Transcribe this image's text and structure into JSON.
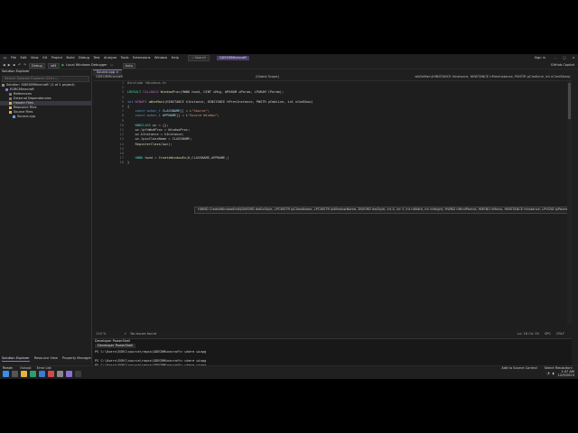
{
  "menu": {
    "items": [
      "File",
      "Edit",
      "View",
      "Git",
      "Project",
      "Build",
      "Debug",
      "Test",
      "Analyze",
      "Tools",
      "Extensions",
      "Window",
      "Help"
    ],
    "search_label": "Search",
    "project": "GDEGRMinecraft",
    "signin": "Sign in",
    "copilot": "GitHub Copilot"
  },
  "toolbar": {
    "config": "Debug",
    "platform": "x64",
    "run_label": "Local Windows Debugger",
    "auto": "Auto"
  },
  "explorer": {
    "title": "Solution Explorer",
    "search_placeholder": "Search Solution Explorer (Ctrl+;)",
    "items": [
      {
        "label": "Solution 'GDEGRMinecraft' (1 of 1 project)",
        "indent": 0,
        "color": "#8a8a8a"
      },
      {
        "label": "EGRCMinecraft",
        "indent": 1,
        "color": "#8c6fd0"
      },
      {
        "label": "References",
        "indent": 2,
        "color": "#7a7a7a"
      },
      {
        "label": "External Dependencies",
        "indent": 2,
        "color": "#7a7a7a"
      },
      {
        "label": "Header Files",
        "indent": 2,
        "color": "#d8b05a"
      },
      {
        "label": "Resource Files",
        "indent": 2,
        "color": "#d8b05a"
      },
      {
        "label": "Source Files",
        "indent": 2,
        "color": "#d8b05a"
      },
      {
        "label": "Source.cpp",
        "indent": 3,
        "color": "#6c9ad6"
      }
    ],
    "selected_index": 4,
    "tabs": [
      "Solution Explorer",
      "Resource View",
      "Property Manager"
    ]
  },
  "editor": {
    "tab": "Source.cpp",
    "nav": [
      "GDEGRMinecraft",
      "(Global Scope)",
      "wWinMain(HINSTANCE hInstance, HINSTANCE hPrevInstance, PWSTR pCmdLine, int nCmdShow)"
    ],
    "tooltip": "HWND CreateWindowExW(DWORD dwExStyle, LPCWSTR lpClassName, LPCWSTR lpWindowName, DWORD dwStyle, int X, int Y, int nWidth, int nHeight, HWND hWndParent, HMENU hMenu, HINSTANCE hInstance, LPVOID lpParam)",
    "status": {
      "zoom": "110 %",
      "issues": "No issues found",
      "position": "Ln: 18  Ch: 55",
      "mode": "SPC",
      "eol": "CRLF"
    }
  },
  "code": [
    [
      {
        "t": "#include <Windows.h>",
        "c": "pp"
      }
    ],
    [],
    [
      {
        "t": "LRESULT ",
        "c": "ty"
      },
      {
        "t": "CALLBACK ",
        "c": "mac"
      },
      {
        "t": "WindowProc",
        "c": "fn"
      },
      {
        "t": "(HWND hwnd, UINT uMsg, WPARAM wParam, LPARAM lParam);",
        "c": ""
      }
    ],
    [],
    [
      {
        "t": "int ",
        "c": "kw"
      },
      {
        "t": "WINAPI ",
        "c": "mac"
      },
      {
        "t": "wWinMain",
        "c": "fn"
      },
      {
        "t": "(HINSTANCE hInstance, HINSTANCE hPrevInstance, PWSTR pCmdLine, int nCmdShow)",
        "c": ""
      }
    ],
    [
      {
        "t": "{",
        "c": ""
      }
    ],
    [
      {
        "t": "    const wchar_t ",
        "c": "kw"
      },
      {
        "t": "CLASSNAME",
        "c": "var"
      },
      {
        "t": "[] = L",
        "c": ""
      },
      {
        "t": "\"Source\"",
        "c": "st"
      },
      {
        "t": ";",
        "c": ""
      }
    ],
    [
      {
        "t": "    const wchar_t ",
        "c": "kw"
      },
      {
        "t": "APPNAME",
        "c": "var"
      },
      {
        "t": "[] = L",
        "c": ""
      },
      {
        "t": "\"Source Window\"",
        "c": "st"
      },
      {
        "t": ";",
        "c": ""
      }
    ],
    [],
    [
      {
        "t": "    WNDCLASS ",
        "c": "ty"
      },
      {
        "t": "wc = {};",
        "c": ""
      }
    ],
    [
      {
        "t": "    wc.lpfnWndProc = WindowProc;",
        "c": ""
      }
    ],
    [
      {
        "t": "    wc.hInstance = hInstance;",
        "c": ""
      }
    ],
    [
      {
        "t": "    wc.lpszClassName = CLASSNAME;",
        "c": ""
      }
    ],
    [
      {
        "t": "    RegisterClass",
        "c": "fn"
      },
      {
        "t": "(&wc);",
        "c": ""
      }
    ],
    [],
    [],
    [
      {
        "t": "    HWND ",
        "c": "ty"
      },
      {
        "t": "hwnd = ",
        "c": ""
      },
      {
        "t": "CreateWindowEx",
        "c": "fn"
      },
      {
        "t": "(0,CLASSNAME,APPNAME,)",
        "c": ""
      }
    ],
    [
      {
        "t": "}",
        "c": ""
      }
    ]
  ],
  "terminal": {
    "title": "Developer PowerShell",
    "tab": "Developer PowerShell",
    "lines": [
      "PS C:\\Users\\EGRC\\source\\repos\\GDEGRMinecraft> where winpg",
      "",
      "PS C:\\Users\\EGRC\\source\\repos\\GDEGRMinecraft> where winpg",
      "PS C:\\Users\\EGRC\\source\\repos\\GDEGRMinecraft> where winpg",
      "",
      "PS C:\\Users\\EGRC\\source\\repos\\GDEGRMinecraft> where winpg",
      "PS C:\\Users\\EGRC\\source\\repos\\GDEGRMinecraft> "
    ]
  },
  "statusbar": {
    "ready": "Ready",
    "tabs": [
      "Output",
      "Error List"
    ],
    "source_control": "Add to Source Control",
    "repo": "Select Repository"
  },
  "taskbar": {
    "icons": [
      {
        "name": "start-icon",
        "color": "#3a8ee6"
      },
      {
        "name": "search-taskbar-icon",
        "color": "#555555"
      },
      {
        "name": "file-explorer-icon",
        "color": "#e3b341"
      },
      {
        "name": "browser-icon",
        "color": "#2f9e6f"
      },
      {
        "name": "store-icon",
        "color": "#3a7bd5"
      },
      {
        "name": "mail-icon",
        "color": "#d14b4b"
      },
      {
        "name": "settings-icon",
        "color": "#888888"
      },
      {
        "name": "visual-studio-icon",
        "color": "#8c6fd0"
      },
      {
        "name": "terminal-icon",
        "color": "#3c3c3c"
      }
    ],
    "time": "1:47 AM",
    "date": "12/9/2023"
  }
}
